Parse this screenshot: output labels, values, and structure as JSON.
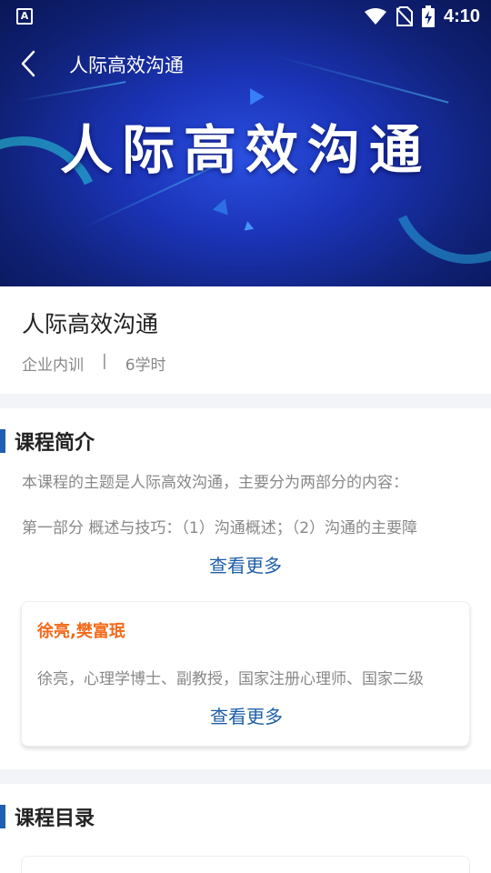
{
  "status_bar": {
    "app_badge": "A",
    "time": "4:10",
    "icons": [
      "wifi-icon",
      "no-sim-icon",
      "battery-charging-icon"
    ]
  },
  "header": {
    "back_icon": "chevron-left-icon",
    "title": "人际高效沟通"
  },
  "banner": {
    "text": "人际高效沟通"
  },
  "course": {
    "title": "人际高效沟通",
    "category": "企业内训",
    "separator": "|",
    "hours": "6学时"
  },
  "intro": {
    "heading": "课程简介",
    "line1": "本课程的主题是人际高效沟通，主要分为两部分的内容：",
    "line2": "第一部分 概述与技巧：（1）沟通概述；（2）沟通的主要障",
    "more": "查看更多"
  },
  "teacher_card": {
    "names": "徐亮,樊富珉",
    "bio": "徐亮，心理学博士、副教授，国家注册心理师、国家二级",
    "more": "查看更多"
  },
  "catalog": {
    "heading": "课程目录"
  },
  "colors": {
    "accent": "#1f5fb4",
    "link": "#1f5fa8",
    "teacher_name": "#f26a1b",
    "muted_text": "#888888",
    "gap_bg": "#f2f4f7"
  }
}
